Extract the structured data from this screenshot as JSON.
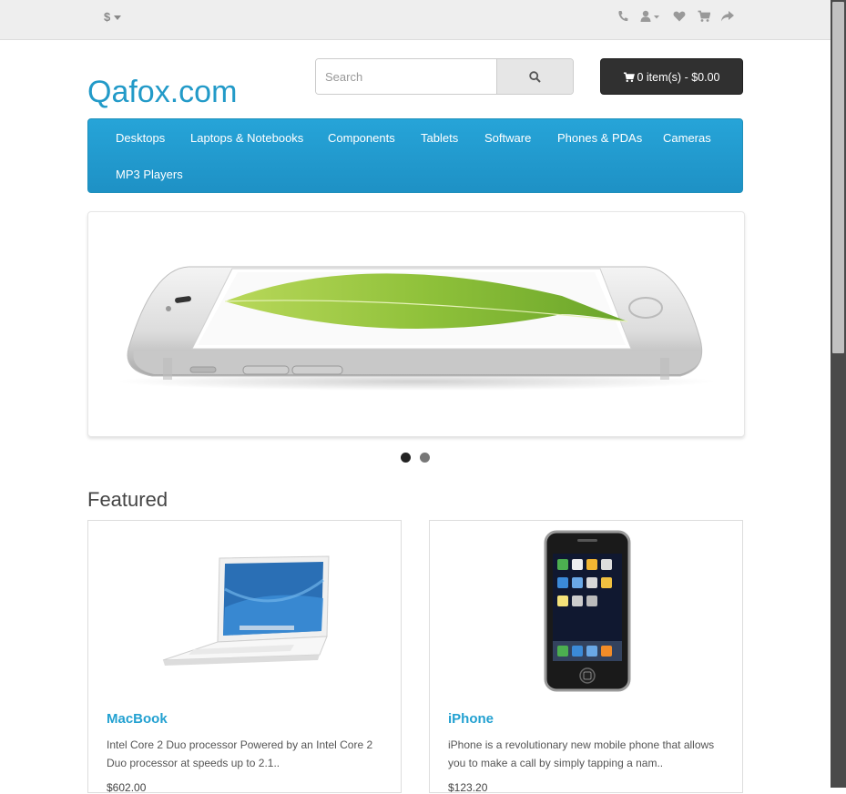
{
  "topbar": {
    "currency": "$",
    "icons": [
      "phone-icon",
      "user-icon",
      "heart-icon",
      "cart-icon",
      "share-icon"
    ]
  },
  "header": {
    "logo": "Qafox.com",
    "search": {
      "placeholder": "Search"
    },
    "cart_label": "0 item(s) - $0.00"
  },
  "menu": {
    "items": [
      {
        "label": "Desktops"
      },
      {
        "label": "Laptops & Notebooks"
      },
      {
        "label": "Components"
      },
      {
        "label": "Tablets"
      },
      {
        "label": "Software"
      },
      {
        "label": "Phones & PDAs"
      },
      {
        "label": "Cameras"
      },
      {
        "label": "MP3 Players"
      }
    ]
  },
  "slider": {
    "image": "iphone-6-banner",
    "dots": 2,
    "active_dot": 1
  },
  "featured": {
    "title": "Featured",
    "products": [
      {
        "name": "MacBook",
        "description": "Intel Core 2 Duo processor Powered by an Intel Core 2 Duo processor at speeds up to 2.1..",
        "price": "$602.00"
      },
      {
        "name": "iPhone",
        "description": "iPhone is a revolutionary new mobile phone that allows you to make a call by simply tapping a nam..",
        "price": "$123.20"
      }
    ]
  },
  "colors": {
    "accent": "#229ac8",
    "menu_bg": "#229ac8",
    "cart_bg": "#303030",
    "topbar_bg": "#eeeeee"
  }
}
